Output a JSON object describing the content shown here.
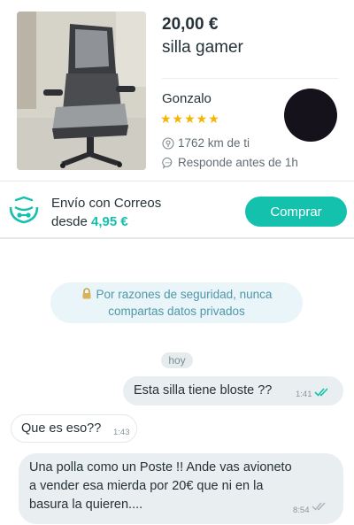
{
  "product": {
    "price": "20,00 €",
    "title": "silla gamer",
    "seller_name": "Gonzalo",
    "rating_stars": 5,
    "stars_text": "★★★★★",
    "distance": "1762 km de ti",
    "response_time": "Responde antes de 1h"
  },
  "shipping": {
    "title": "Envío con Correos",
    "price_prefix": "desde",
    "price": "4,95 €",
    "buy_label": "Comprar"
  },
  "chat": {
    "security_notice_line1": "Por razones de seguridad, nunca",
    "security_notice_line2": "compartas datos privados",
    "day_label": "hoy",
    "messages": [
      {
        "direction": "outgoing",
        "text": "Esta silla tiene bloste ??",
        "time": "1:41",
        "read": true
      },
      {
        "direction": "incoming",
        "text": "Que es eso??",
        "time": "1:43"
      },
      {
        "direction": "incoming",
        "lines": [
          "Una polla como un Poste  !! Ande vas avioneto",
          "a vender esa mierda por 20€ que ni en la",
          "basura la quieren...."
        ],
        "time": "8:54",
        "read": false
      }
    ]
  },
  "colors": {
    "accent": "#13c1ac",
    "text": "#253238",
    "star": "#f4b400",
    "bubble": "#e9eef0",
    "security_bg": "#e9f5f8",
    "security_text": "#4f97a8"
  },
  "icons": {
    "location": "location-pin-icon",
    "response": "chat-bubble-icon",
    "shipping": "correos-logo",
    "lock": "lock-icon",
    "read_receipt": "double-check-icon"
  }
}
